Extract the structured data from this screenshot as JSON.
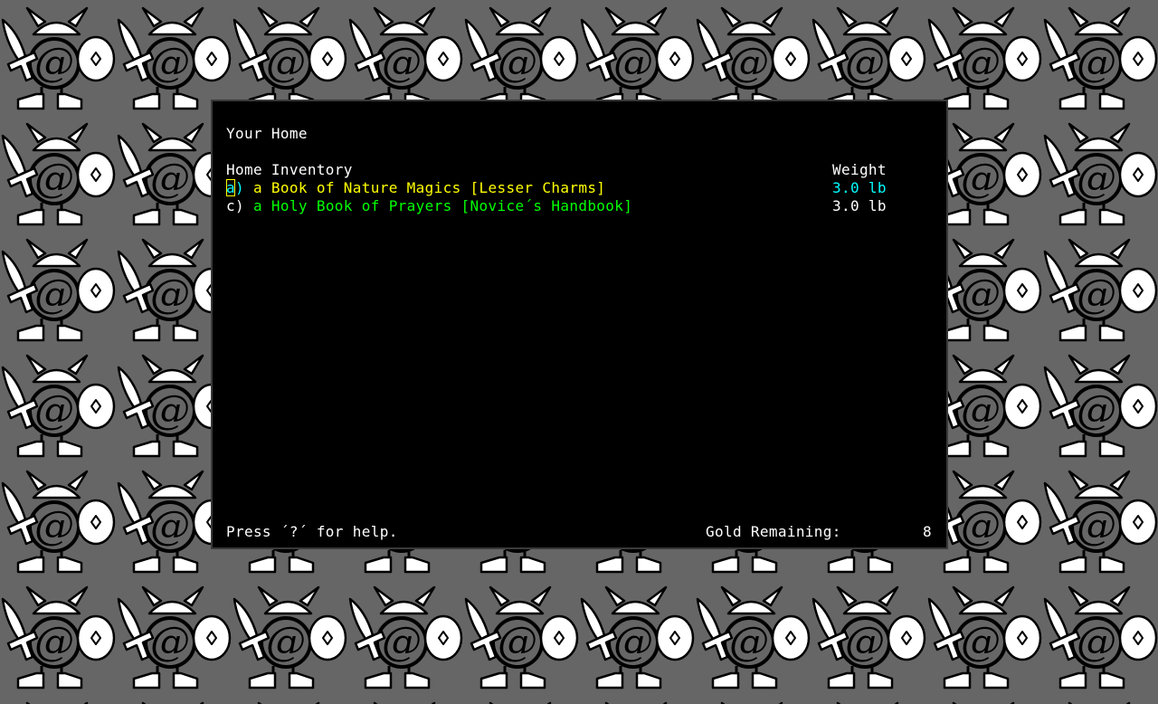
{
  "title": "Your Home",
  "inventory": {
    "header": "Home Inventory",
    "weight_header": "Weight",
    "items": [
      {
        "letter": "a",
        "paren": ")",
        "name": "a Book of Nature Magics [Lesser Charms]",
        "weight": "3.0 lb",
        "color": "#ffff00"
      },
      {
        "letter": "c",
        "paren": ")",
        "name": "a Holy Book of Prayers [Novice´s Handbook]",
        "weight": "3.0 lb",
        "color": "#00ff00"
      }
    ]
  },
  "footer": {
    "help": "Press ´?´ for help.",
    "gold_label": "Gold Remaining:",
    "gold_value": "8"
  },
  "background_tile": {
    "glyph": "@",
    "icon": "adventurer-with-sword-and-shield-icon"
  }
}
